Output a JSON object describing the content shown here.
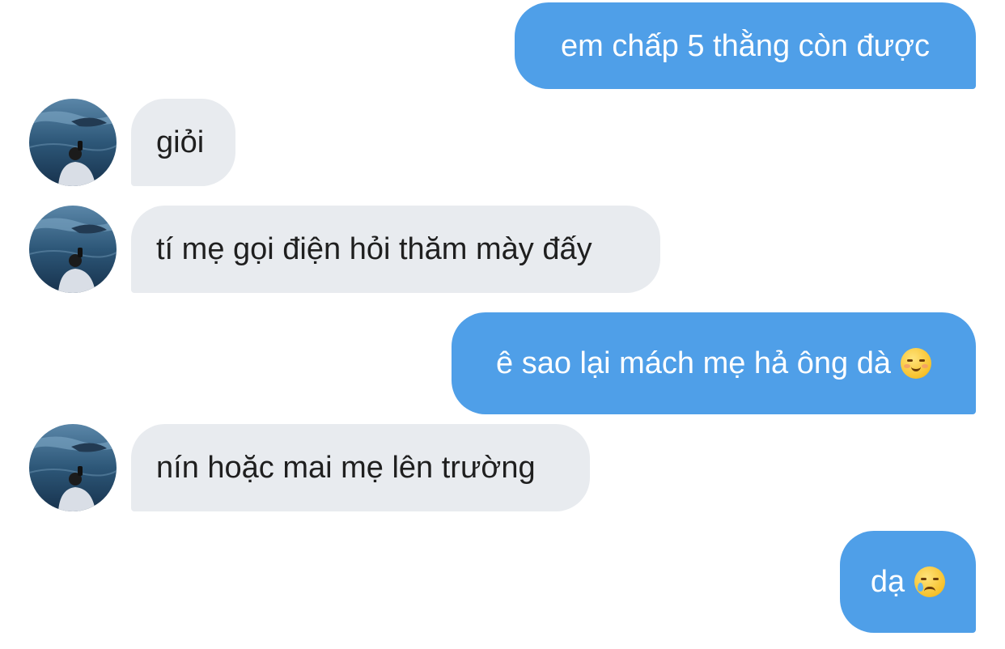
{
  "messages": [
    {
      "id": 1,
      "direction": "outgoing",
      "text": "em chấp 5 thằng còn được"
    },
    {
      "id": 2,
      "direction": "incoming",
      "text": "giỏi"
    },
    {
      "id": 3,
      "direction": "incoming",
      "text": "tí mẹ gọi điện hỏi thăm mày đấy"
    },
    {
      "id": 4,
      "direction": "outgoing",
      "text": "ê sao lại mách mẹ hả ông dà",
      "emoji": "smiling-face-with-blush-icon"
    },
    {
      "id": 5,
      "direction": "incoming",
      "text": "nín hoặc mai mẹ lên trường"
    },
    {
      "id": 6,
      "direction": "outgoing",
      "text": "dạ",
      "emoji": "face-holding-back-tears-icon"
    }
  ],
  "colors": {
    "outgoing_bubble": "#4f9fe8",
    "incoming_bubble": "#e8ebef",
    "outgoing_text": "#ffffff",
    "incoming_text": "#1f1f1f"
  }
}
